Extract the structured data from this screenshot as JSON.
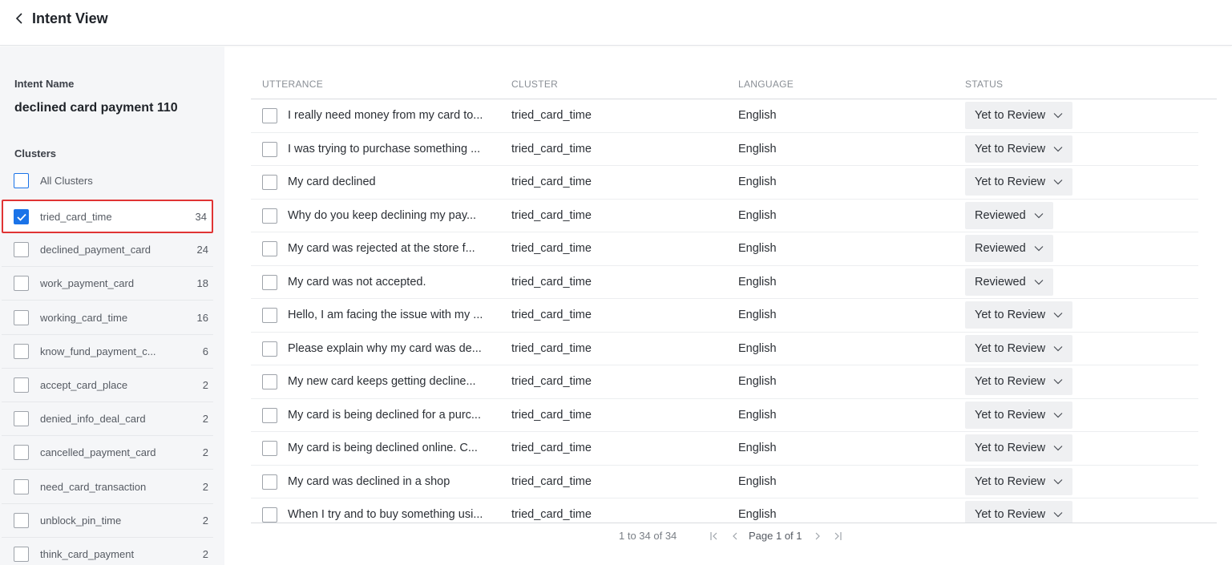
{
  "header": {
    "title": "Intent View"
  },
  "sidebar": {
    "intent_name_label": "Intent Name",
    "intent_name_value": "declined card payment 110",
    "clusters_label": "Clusters",
    "all_clusters_label": "All Clusters",
    "clusters": [
      {
        "name": "tried_card_time",
        "count": "34"
      },
      {
        "name": "declined_payment_card",
        "count": "24"
      },
      {
        "name": "work_payment_card",
        "count": "18"
      },
      {
        "name": "working_card_time",
        "count": "16"
      },
      {
        "name": "know_fund_payment_c...",
        "count": "6"
      },
      {
        "name": "accept_card_place",
        "count": "2"
      },
      {
        "name": "denied_info_deal_card",
        "count": "2"
      },
      {
        "name": "cancelled_payment_card",
        "count": "2"
      },
      {
        "name": "need_card_transaction",
        "count": "2"
      },
      {
        "name": "unblock_pin_time",
        "count": "2"
      },
      {
        "name": "think_card_payment",
        "count": "2"
      }
    ]
  },
  "table": {
    "headers": {
      "utterance": "UTTERANCE",
      "cluster": "CLUSTER",
      "language": "LANGUAGE",
      "status": "STATUS"
    },
    "rows": [
      {
        "utterance": "I really need money from my card to...",
        "cluster": "tried_card_time",
        "language": "English",
        "status": "Yet to Review"
      },
      {
        "utterance": "I was trying to purchase something ...",
        "cluster": "tried_card_time",
        "language": "English",
        "status": "Yet to Review"
      },
      {
        "utterance": "My card declined",
        "cluster": "tried_card_time",
        "language": "English",
        "status": "Yet to Review"
      },
      {
        "utterance": "Why do you keep declining my pay...",
        "cluster": "tried_card_time",
        "language": "English",
        "status": "Reviewed"
      },
      {
        "utterance": "My card was rejected at the store f...",
        "cluster": "tried_card_time",
        "language": "English",
        "status": "Reviewed"
      },
      {
        "utterance": "My card was not accepted.",
        "cluster": "tried_card_time",
        "language": "English",
        "status": "Reviewed"
      },
      {
        "utterance": "Hello, I am facing the issue with my ...",
        "cluster": "tried_card_time",
        "language": "English",
        "status": "Yet to Review"
      },
      {
        "utterance": "Please explain why my card was de...",
        "cluster": "tried_card_time",
        "language": "English",
        "status": "Yet to Review"
      },
      {
        "utterance": "My new card keeps getting decline...",
        "cluster": "tried_card_time",
        "language": "English",
        "status": "Yet to Review"
      },
      {
        "utterance": "My card is being declined for a purc...",
        "cluster": "tried_card_time",
        "language": "English",
        "status": "Yet to Review"
      },
      {
        "utterance": "My card is being declined online. C...",
        "cluster": "tried_card_time",
        "language": "English",
        "status": "Yet to Review"
      },
      {
        "utterance": "My card was declined in a shop",
        "cluster": "tried_card_time",
        "language": "English",
        "status": "Yet to Review"
      },
      {
        "utterance": "When I try and to buy something usi...",
        "cluster": "tried_card_time",
        "language": "English",
        "status": "Yet to Review"
      }
    ]
  },
  "pagination": {
    "range": "1 to 34 of 34",
    "page": "Page 1 of 1"
  },
  "colors": {
    "accent": "#1a73e8",
    "selection_outline": "#e03434",
    "sidebar_bg": "#f5f6f8",
    "status_bg": "#eff0f2"
  },
  "icons": [
    "chevron-left-icon",
    "check-icon",
    "chevron-down-icon",
    "first-page-icon",
    "prev-page-icon",
    "next-page-icon",
    "last-page-icon"
  ]
}
